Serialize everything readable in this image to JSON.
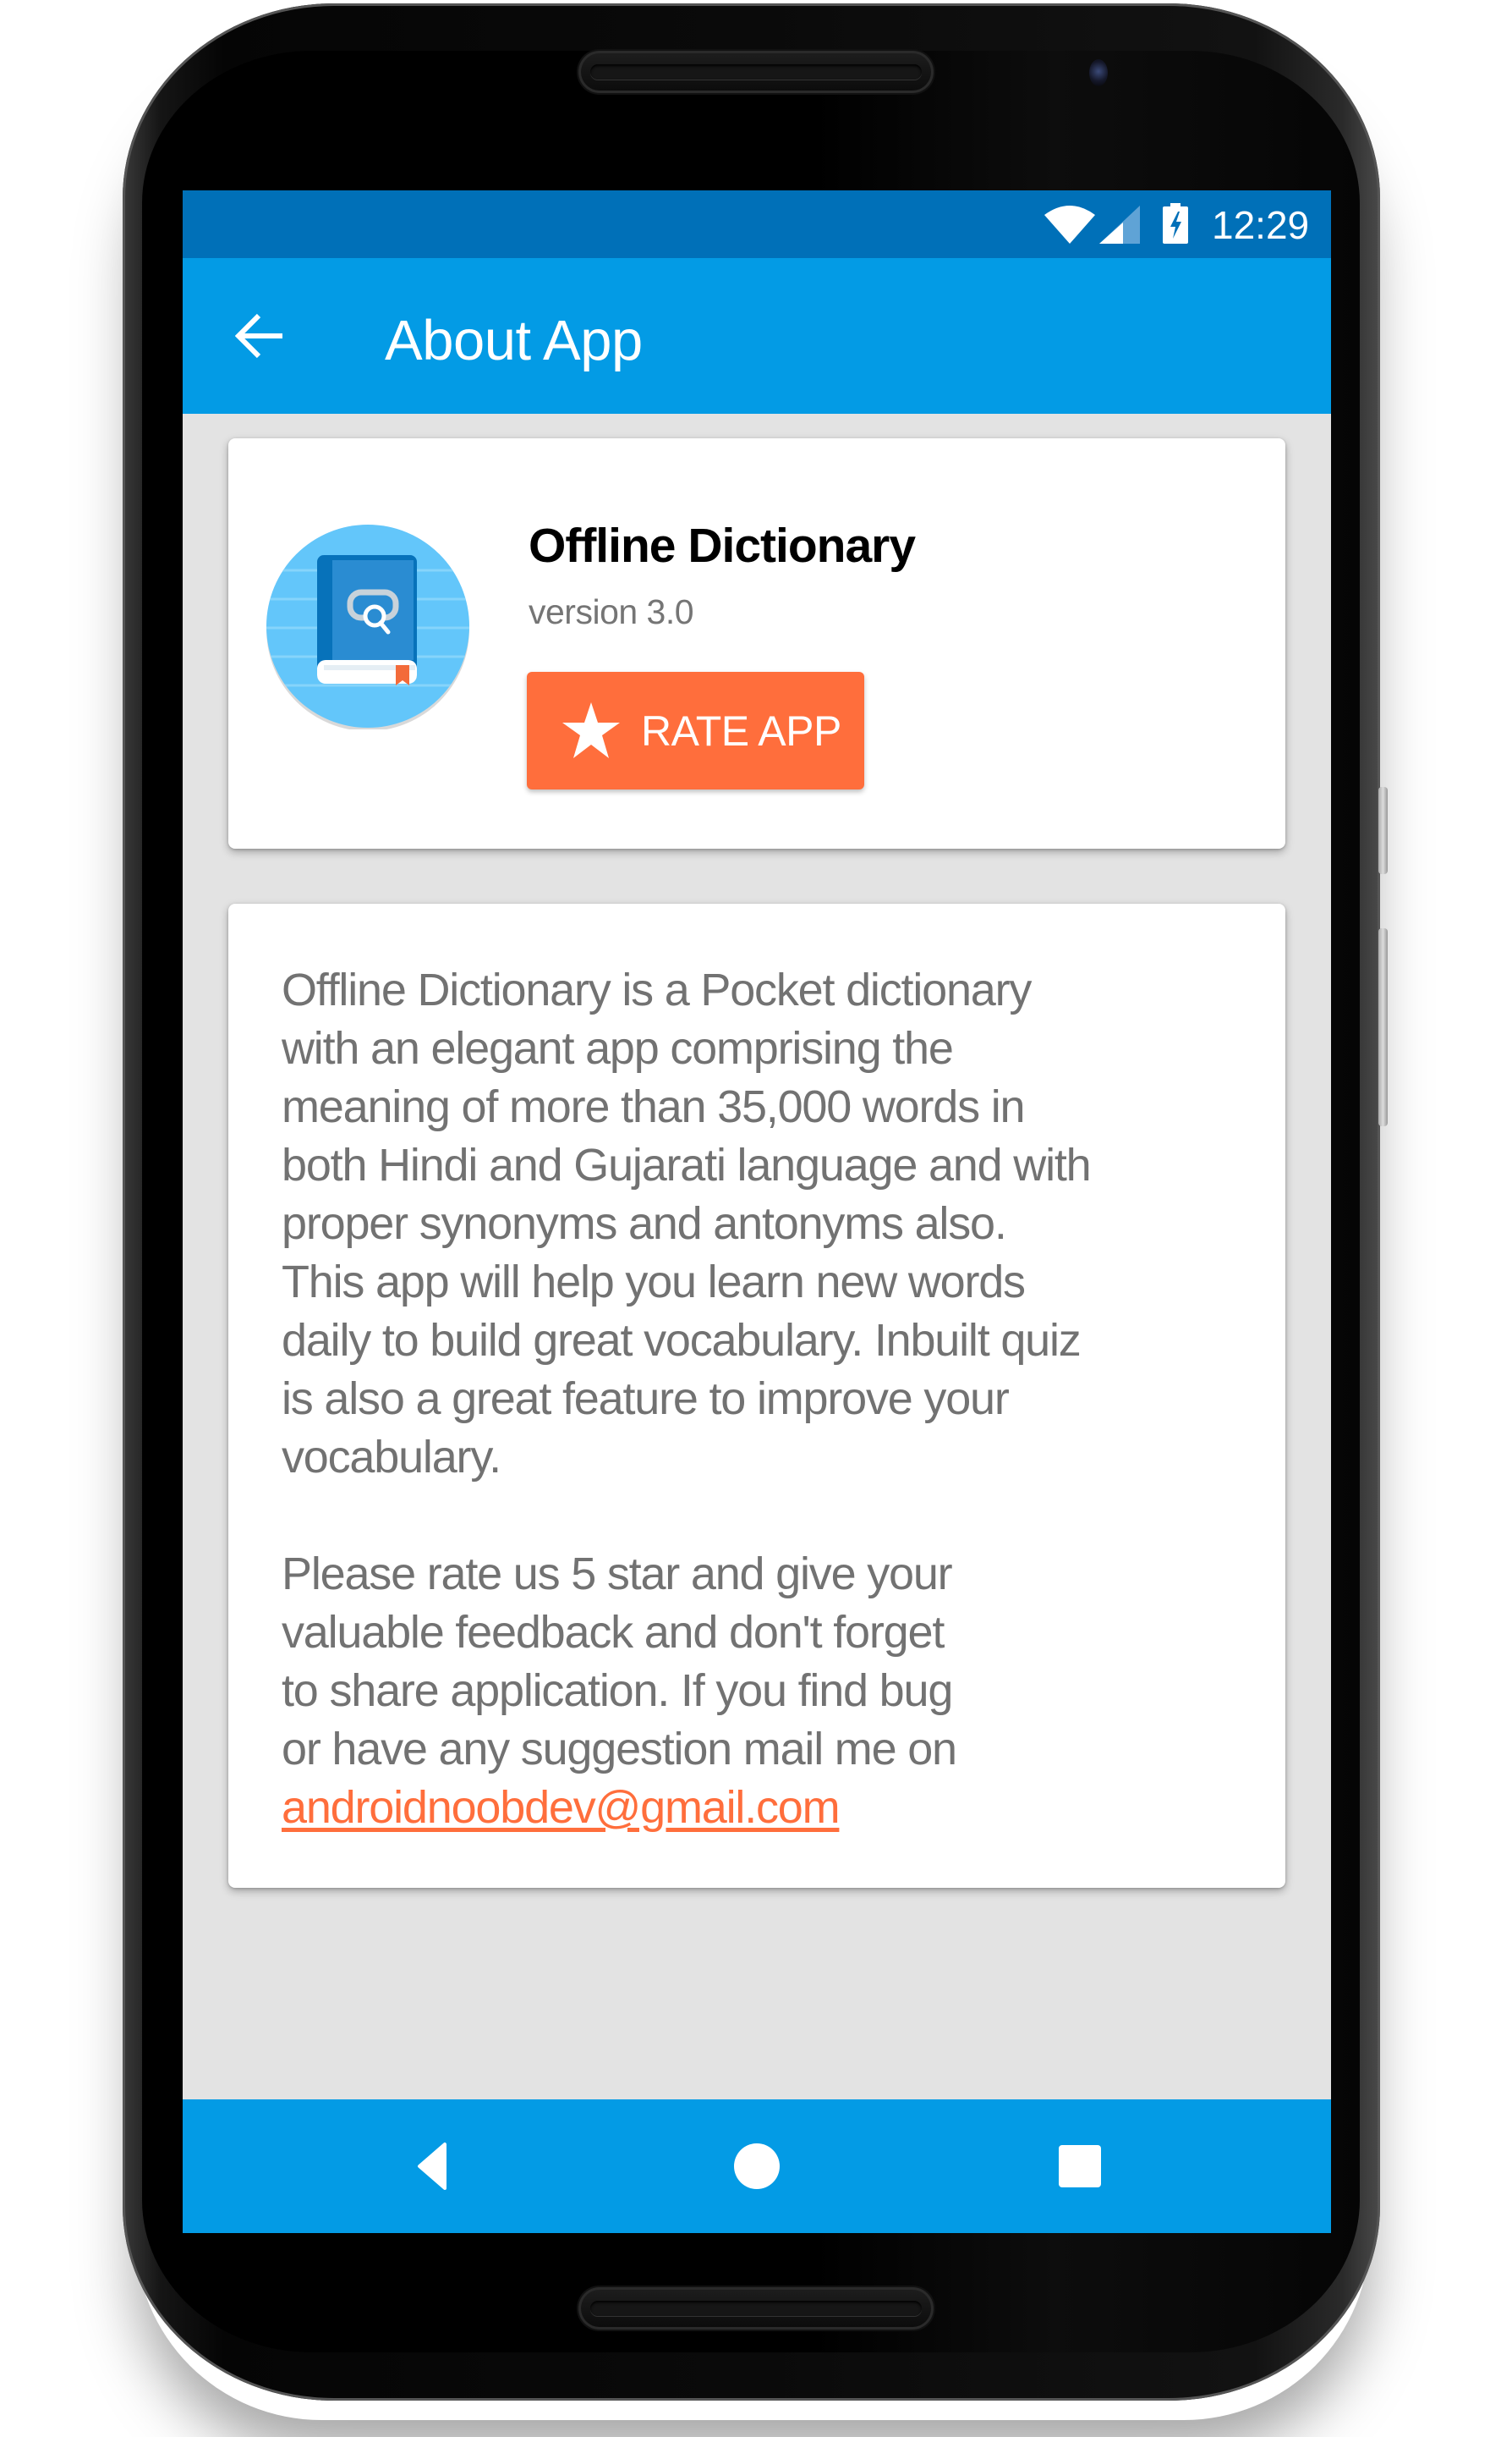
{
  "status_bar": {
    "time": "12:29",
    "icons": [
      "wifi-icon",
      "cell-signal-icon",
      "battery-charging-icon"
    ]
  },
  "app_bar": {
    "back_icon": "arrow-left-icon",
    "title": "About App"
  },
  "app_info": {
    "icon": "dictionary-book-icon",
    "name": "Offline Dictionary",
    "version": "version 3.0",
    "rate_button": {
      "icon": "star-icon",
      "label": "RATE APP"
    }
  },
  "description": {
    "paragraph1_lines": [
      "Offline Dictionary is a Pocket dictionary",
      "with an elegant app comprising the",
      "meaning of more than 35,000 words in",
      "both Hindi and Gujarati language and with",
      "proper synonyms and antonyms also.",
      "This app will help you learn new words",
      "daily to build great vocabulary. Inbuilt quiz",
      "is also a great feature to improve your",
      "vocabulary."
    ],
    "paragraph2_lines": [
      "Please rate us 5 star and give your",
      "valuable feedback and don't forget",
      "to share application. If you find bug",
      "or have any suggestion mail me on"
    ],
    "email": "androidnoobdev@gmail.com"
  },
  "nav_bar": {
    "buttons": [
      {
        "name": "back",
        "icon": "triangle-back-icon"
      },
      {
        "name": "home",
        "icon": "circle-home-icon"
      },
      {
        "name": "recents",
        "icon": "square-recents-icon"
      }
    ]
  },
  "colors": {
    "status_bar": "#0070B8",
    "app_bar": "#039BE5",
    "background": "#E3E3E3",
    "accent": "#FF6E3C",
    "body_text": "#727272",
    "title_text": "#000000"
  }
}
